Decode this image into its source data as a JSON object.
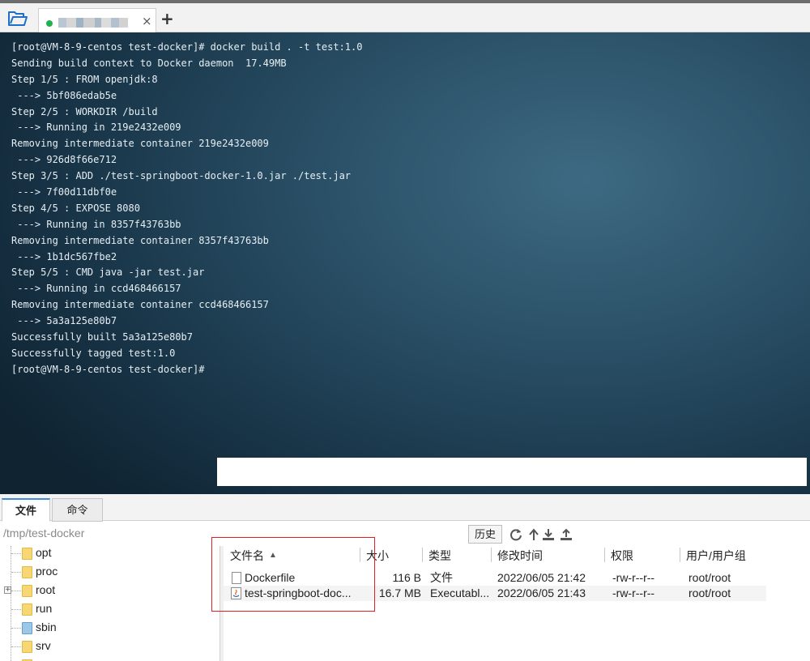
{
  "top_bar": {
    "session_tab": {
      "status_color": "#22b14c",
      "close_label": "×"
    },
    "add_tab_label": "+"
  },
  "terminal": {
    "lines": [
      "[root@VM-8-9-centos test-docker]# docker build . -t test:1.0",
      "Sending build context to Docker daemon  17.49MB",
      "Step 1/5 : FROM openjdk:8",
      " ---> 5bf086edab5e",
      "Step 2/5 : WORKDIR /build",
      " ---> Running in 219e2432e009",
      "Removing intermediate container 219e2432e009",
      " ---> 926d8f66e712",
      "Step 3/5 : ADD ./test-springboot-docker-1.0.jar ./test.jar",
      " ---> 7f00d11dbf0e",
      "Step 4/5 : EXPOSE 8080",
      " ---> Running in 8357f43763bb",
      "Removing intermediate container 8357f43763bb",
      " ---> 1b1dc567fbe2",
      "Step 5/5 : CMD java -jar test.jar",
      " ---> Running in ccd468466157",
      "Removing intermediate container ccd468466157",
      " ---> 5a3a125e80b7",
      "Successfully built 5a3a125e80b7",
      "Successfully tagged test:1.0",
      "[root@VM-8-9-centos test-docker]#"
    ],
    "resize_dots": "....."
  },
  "panel_tabs": {
    "files": "文件",
    "commands": "命令"
  },
  "path_bar": {
    "path": "/tmp/test-docker",
    "history_label": "历史"
  },
  "tree": {
    "items": [
      {
        "label": "opt"
      },
      {
        "label": "proc"
      },
      {
        "label": "root",
        "expander": "+"
      },
      {
        "label": "run"
      },
      {
        "label": "sbin"
      },
      {
        "label": "srv"
      },
      {
        "label": "sys"
      }
    ]
  },
  "file_list": {
    "columns": {
      "name": "文件名",
      "size": "大小",
      "type": "类型",
      "modified": "修改时间",
      "permissions": "权限",
      "owner": "用户/用户组"
    },
    "sort_indicator": "▲",
    "rows": [
      {
        "name": "Dockerfile",
        "size": "116 B",
        "type": "文件",
        "modified": "2022/06/05 21:42",
        "permissions": "-rw-r--r--",
        "owner": "root/root",
        "icon": "file-icon"
      },
      {
        "name": "test-springboot-doc...",
        "size": "16.7 MB",
        "type": "Executabl...",
        "modified": "2022/06/05 21:43",
        "permissions": "-rw-r--r--",
        "owner": "root/root",
        "icon": "java-jar-icon"
      }
    ]
  },
  "colors": {
    "highlight_box": "#e02020",
    "active_tab_accent": "#3f8cd8"
  }
}
